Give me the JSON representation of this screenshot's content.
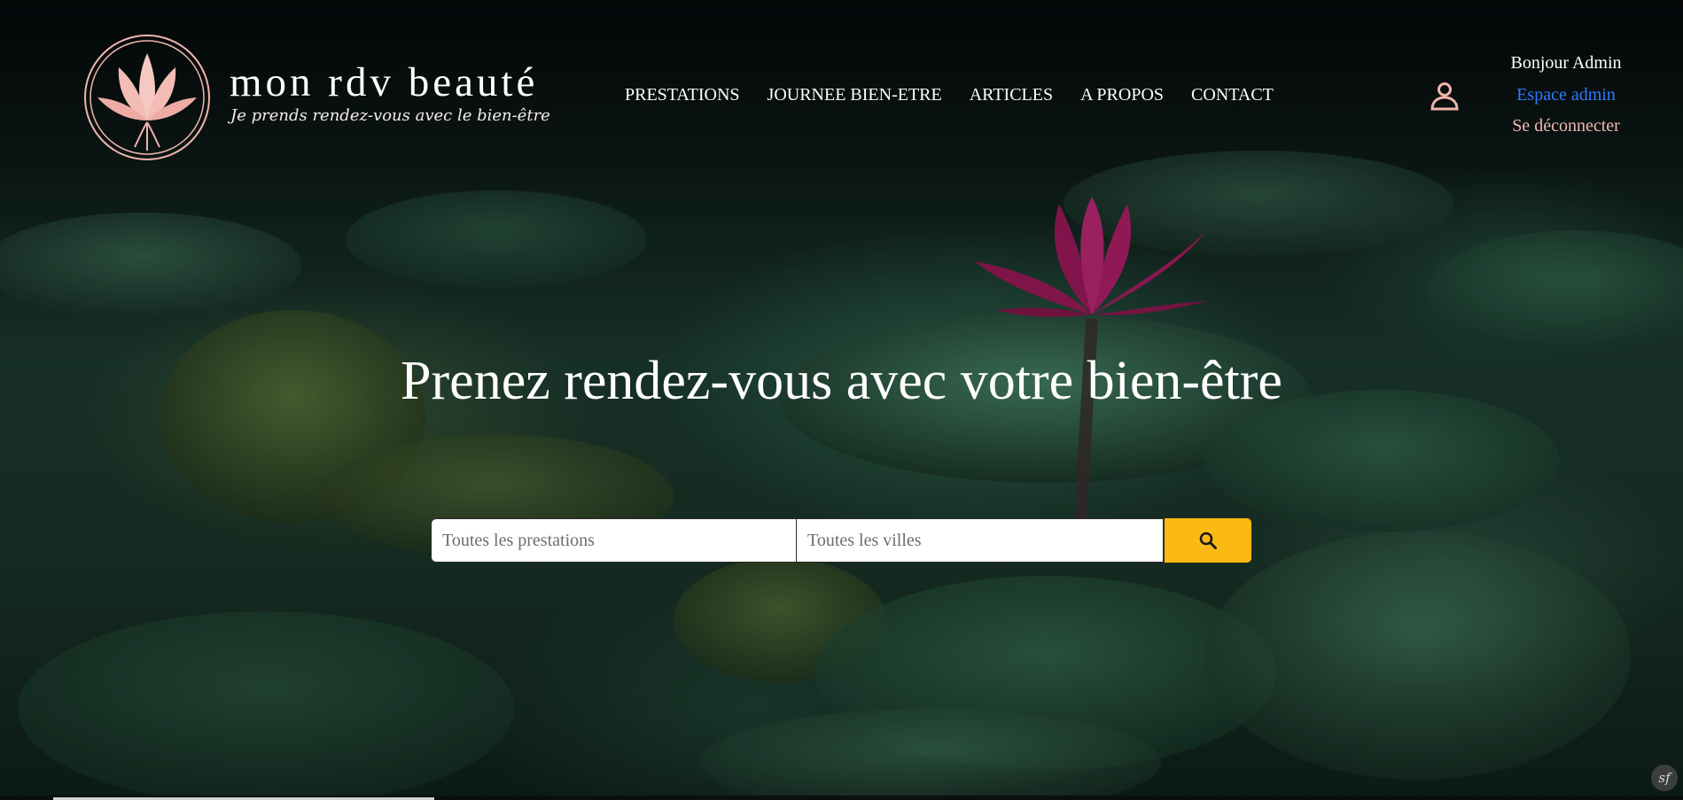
{
  "header": {
    "brand_name": "mon rdv beauté",
    "tagline": "Je prends rendez-vous avec le bien-être",
    "logo_icon": "lotus-logo-icon",
    "nav": [
      "PRESTATIONS",
      "JOURNEE BIEN-ETRE",
      "ARTICLES",
      "A PROPOS",
      "CONTACT"
    ]
  },
  "user": {
    "greeting": "Bonjour Admin",
    "admin_link": "Espace admin",
    "logout": "Se déconnecter",
    "icon": "user-icon"
  },
  "hero": {
    "title": "Prenez rendez-vous avec votre bien-être"
  },
  "search": {
    "service_placeholder": "Toutes les prestations",
    "city_placeholder": "Toutes les villes",
    "button_icon": "search-icon"
  },
  "colors": {
    "accent": "#fdb913",
    "admin_link": "#2d7bff",
    "logout_link": "#f2b8b5",
    "logo_pink": "#f0b4ad"
  },
  "badge": {
    "icon": "symfony-icon",
    "text": "sf"
  }
}
